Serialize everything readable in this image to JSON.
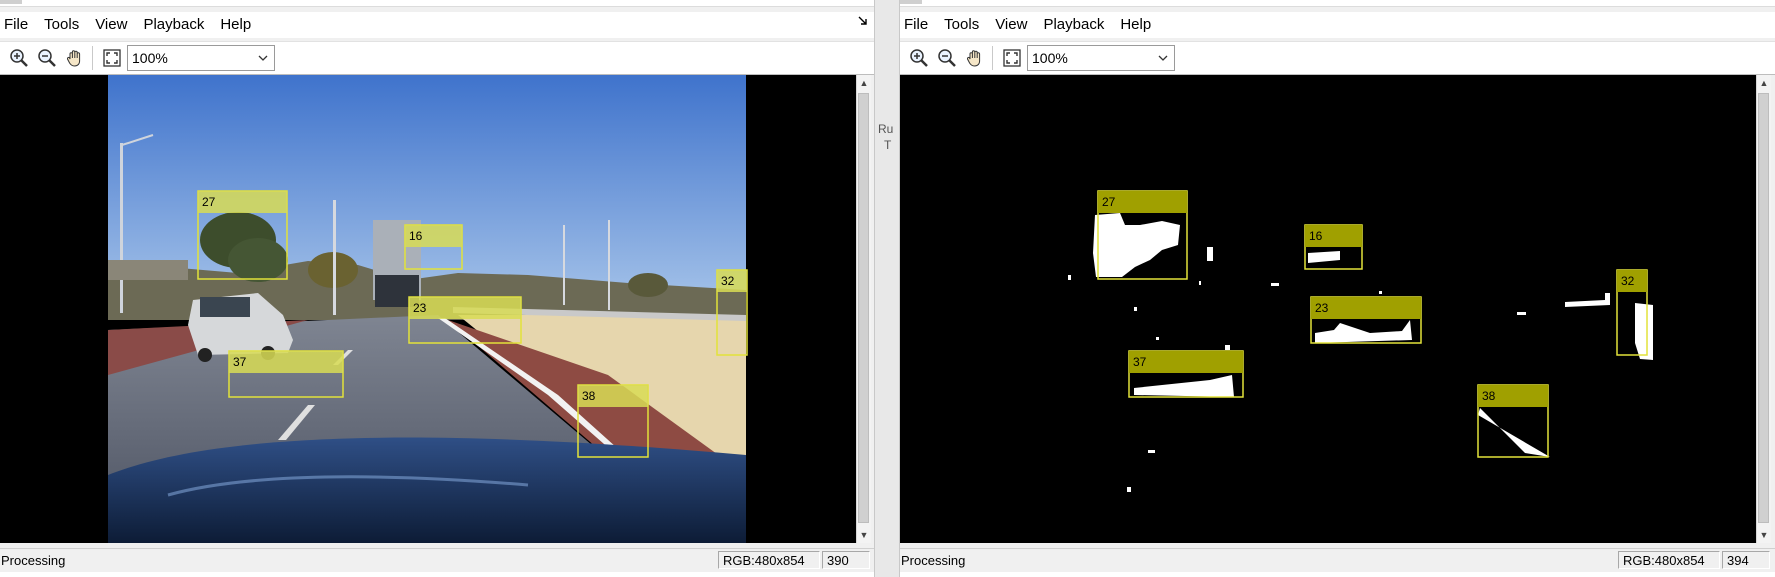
{
  "left_window": {
    "menu": [
      "File",
      "Tools",
      "View",
      "Playback",
      "Help"
    ],
    "zoom": "100%",
    "status": "Processing",
    "resolution": "RGB:480x854",
    "frame_number": "390",
    "detections": [
      "27",
      "16",
      "23",
      "32",
      "37",
      "38"
    ]
  },
  "right_window": {
    "menu": [
      "File",
      "Tools",
      "View",
      "Playback",
      "Help"
    ],
    "zoom": "100%",
    "status": "Processing",
    "resolution": "RGB:480x854",
    "frame_number": "394",
    "detections": [
      "27",
      "16",
      "23",
      "32",
      "37",
      "38"
    ]
  },
  "background_window": {
    "partial_text": [
      "Ru",
      "T"
    ]
  },
  "icons": [
    "zoom-in-icon",
    "zoom-out-icon",
    "pan-hand-icon",
    "fit-to-window-icon",
    "undock-icon",
    "scroll-up-icon",
    "scroll-down-icon"
  ],
  "colors": {
    "detection_label_left": "#d8dc55",
    "detection_box": "#e2e23a",
    "detection_label_right": "#a0a000"
  }
}
